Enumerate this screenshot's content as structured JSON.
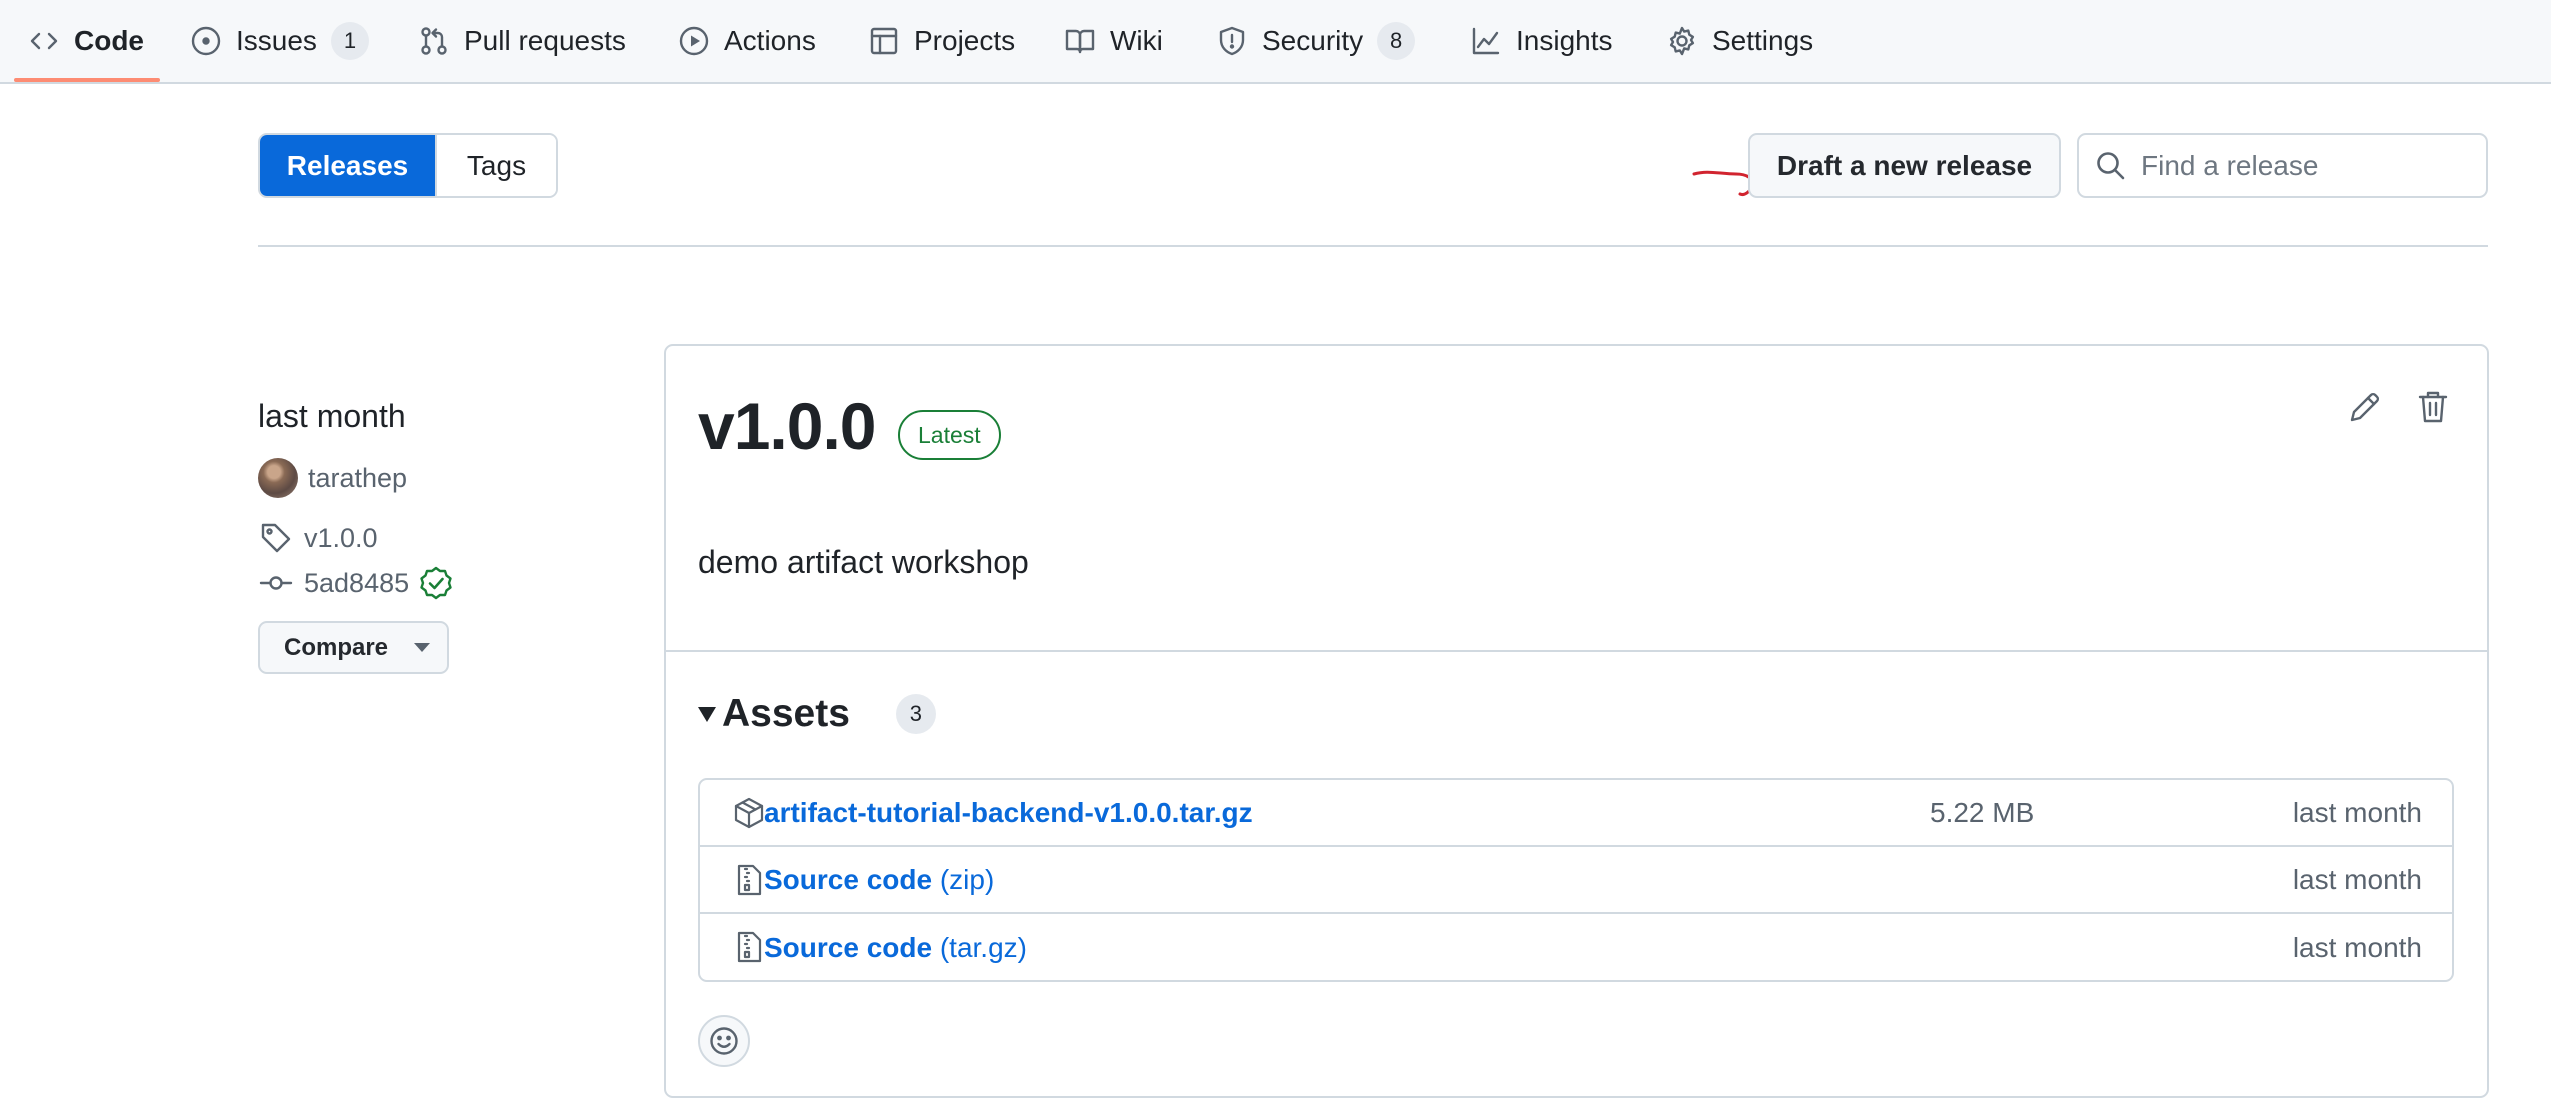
{
  "repo_nav": {
    "items": [
      {
        "label": "Code",
        "icon": "code-icon",
        "selected": true
      },
      {
        "label": "Issues",
        "icon": "issue-opened-icon",
        "count": "1"
      },
      {
        "label": "Pull requests",
        "icon": "git-pull-request-icon"
      },
      {
        "label": "Actions",
        "icon": "play-icon"
      },
      {
        "label": "Projects",
        "icon": "table-icon"
      },
      {
        "label": "Wiki",
        "icon": "book-icon"
      },
      {
        "label": "Security",
        "icon": "shield-icon",
        "count": "8"
      },
      {
        "label": "Insights",
        "icon": "graph-icon"
      },
      {
        "label": "Settings",
        "icon": "gear-icon"
      }
    ],
    "underline_color": "#fd8c73"
  },
  "subnav": {
    "releases_label": "Releases",
    "tags_label": "Tags",
    "draft_button_label": "Draft a new release",
    "search_placeholder": "Find a release",
    "search_value": ""
  },
  "release": {
    "date": "last month",
    "author": "tarathep",
    "tag": "v1.0.0",
    "commit": "5ad8485",
    "commit_verified": true,
    "compare_label": "Compare",
    "title": "v1.0.0",
    "badge": "Latest",
    "description": "demo artifact workshop",
    "assets_title": "Assets",
    "assets_count": "3",
    "assets": [
      {
        "icon": "package-icon",
        "name": "artifact-tutorial-backend-v1.0.0.tar.gz",
        "suffix": "",
        "size": "5.22 MB",
        "date": "last month"
      },
      {
        "icon": "file-zip-icon",
        "name": "Source code",
        "suffix": " (zip)",
        "size": "",
        "date": "last month"
      },
      {
        "icon": "file-zip-icon",
        "name": "Source code",
        "suffix": " (tar.gz)",
        "size": "",
        "date": "last month"
      }
    ]
  },
  "colors": {
    "accent": "#0969da",
    "success": "#1a7f37",
    "annotation": "#d1242f"
  }
}
